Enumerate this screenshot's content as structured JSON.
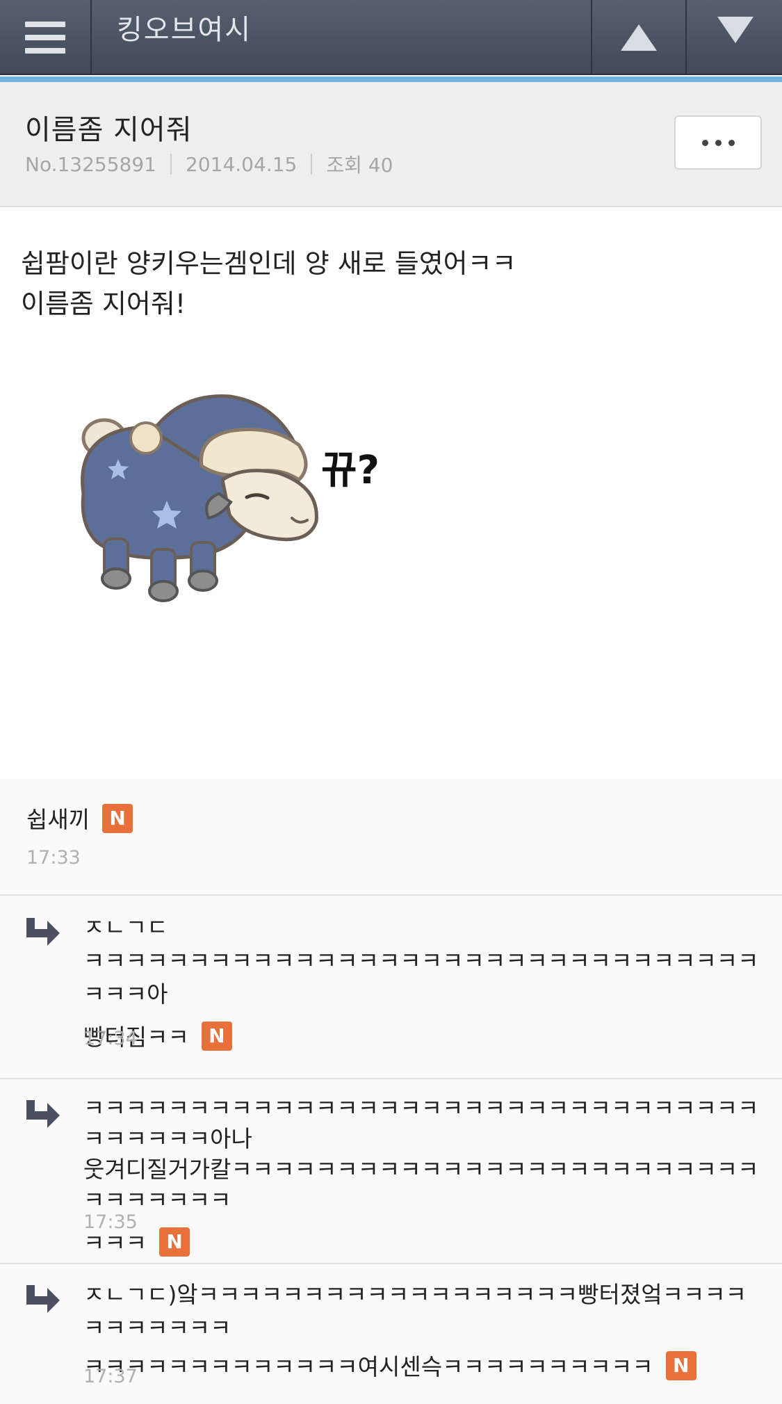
{
  "app": {
    "title": "킹오브여시"
  },
  "icons": {
    "menu": "hamburger-menu-icon",
    "up": "arrow-up-icon",
    "down": "arrow-down-icon",
    "more": "more-dots-icon",
    "reply": "reply-arrow-icon"
  },
  "colors": {
    "topbar": "#4b5462",
    "accent": "#6fb5dd",
    "badge": "#e8703a"
  },
  "post": {
    "title": "이름좀 지어줘",
    "number": "No.13255891",
    "date": "2014.04.15",
    "views": "조회 40",
    "body_line1": "쉽팜이란 양키우는겜인데 양 새로 들였어ㅋㅋ",
    "body_line2": "이름좀 지어줘!",
    "sticker_text": "뀨?"
  },
  "comments": [
    {
      "text": "쉽새끼",
      "badge": "N",
      "time": "17:33"
    },
    {
      "line1": "ㅈㄴㄱㄷ",
      "line2": "ㅋㅋㅋㅋㅋㅋㅋㅋㅋㅋㅋㅋㅋㅋㅋㅋㅋㅋㅋㅋㅋㅋㅋㅋㅋㅋㅋㅋㅋㅋㅋㅋㅋㅋㅋ아",
      "line3": "빵터짐ㅋㅋ",
      "badge": "N",
      "time": "17:34"
    },
    {
      "line1": "ㅋㅋㅋㅋㅋㅋㅋㅋㅋㅋㅋㅋㅋㅋㅋㅋㅋㅋㅋㅋㅋㅋㅋㅋㅋㅋㅋㅋㅋㅋㅋㅋㅋㅋㅋㅋㅋㅋ아나",
      "line2": "웃겨디질거가칼ㅋㅋㅋㅋㅋㅋㅋㅋㅋㅋㅋㅋㅋㅋㅋㅋㅋㅋㅋㅋㅋㅋㅋㅋㅋㅋㅋㅋㅋㅋㅋㅋ",
      "line3": "ㅋㅋㅋ",
      "badge": "N",
      "time": "17:35"
    },
    {
      "line1": "ㅈㄴㄱㄷ)앜ㅋㅋㅋㅋㅋㅋㅋㅋㅋㅋㅋㅋㅋㅋㅋㅋㅋㅋ빵터졌엌ㅋㅋㅋㅋㅋㅋㅋㅋㅋㅋㅋ",
      "line2": "ㅋㅋㅋㅋㅋㅋㅋㅋㅋㅋㅋㅋㅋ여시센슥ㅋㅋㅋㅋㅋㅋㅋㅋㅋㅋ",
      "badge": "N",
      "time": "17:37"
    }
  ]
}
